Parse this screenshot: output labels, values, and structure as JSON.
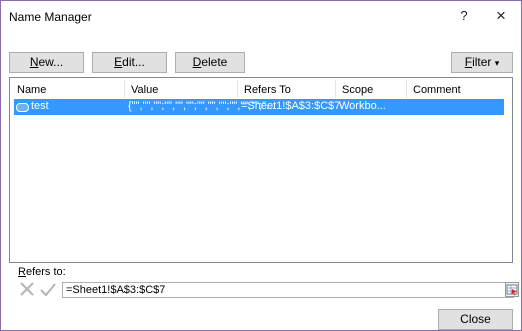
{
  "window": {
    "title": "Name Manager",
    "help": "?",
    "close": "×"
  },
  "toolbar": {
    "new_label": "New...",
    "new_accel": "N",
    "new_rest": "ew...",
    "edit_label": "Edit...",
    "edit_accel": "E",
    "edit_rest": "dit...",
    "delete_label": "Delete",
    "delete_accel": "D",
    "delete_rest": "elete",
    "filter_label": "Filter",
    "filter_accel": "F",
    "filter_rest": "ilter",
    "filter_arrow": "▾"
  },
  "list": {
    "columns": [
      "Name",
      "Value",
      "Refers To",
      "Scope",
      "Comment"
    ],
    "rows": [
      {
        "name": "test",
        "value": "{\"\",\"\",\"\";\"\",\"\",\"\";\"\",\"\",\"\";\"\",\"\",\"\";\"...",
        "refers_to": "=Sheet1!$A$3:$C$7",
        "scope": "Workbo...",
        "comment": ""
      }
    ]
  },
  "refers_to": {
    "label": "Refers to:",
    "accel": "R",
    "rest": "efers to:",
    "value": "=Sheet1!$A$3:$C$7"
  },
  "footer": {
    "close_label": "Close"
  },
  "colors": {
    "selection": "#3399ff",
    "border": "#8a6db0"
  }
}
